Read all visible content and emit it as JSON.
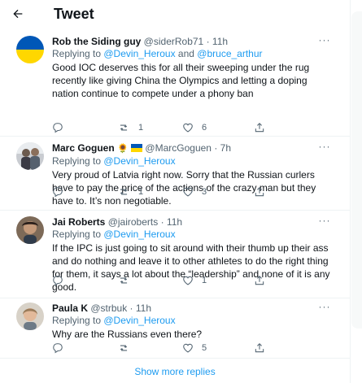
{
  "header": {
    "title": "Tweet"
  },
  "tweets": [
    {
      "name": "Rob the Siding guy",
      "handle": "@siderRob71",
      "time": "11h",
      "reply_prefix": "Replying to ",
      "mention1": "@Devin_Heroux",
      "mention_join": " and ",
      "mention2": "@bruce_arthur",
      "text": "Good IOC deserves this for all their sweeping under the rug recently like giving China the Olympics and letting a doping nation continue to compete under a phony ban",
      "retweets": "1",
      "likes": "6"
    },
    {
      "name": "Marc Goguen",
      "name_emoji": "🌻",
      "handle": "@MarcGoguen",
      "time": "7h",
      "reply_prefix": "Replying to ",
      "mention1": "@Devin_Heroux",
      "text": "Very proud of Latvia right now. Sorry that the Russian curlers have to pay the price of the actions of the crazy man but they have to. It’s non negotiable.",
      "retweets": "1",
      "likes": "3"
    },
    {
      "name": "Jai Roberts",
      "handle": "@jairoberts",
      "time": "11h",
      "reply_prefix": "Replying to ",
      "mention1": "@Devin_Heroux",
      "text": "If the IPC is just going to sit around with their thumb up their ass and do nothing and leave it to other athletes to do the right thing for them, it says a lot about the “leadership” and none of it is any good.",
      "likes": "1"
    },
    {
      "name": "Paula K",
      "handle": "@strbuk",
      "time": "11h",
      "reply_prefix": "Replying to ",
      "mention1": "@Devin_Heroux",
      "text": "Why are the Russians even there?",
      "likes": "5"
    }
  ],
  "separator": " · ",
  "more_glyph": "···",
  "show_more": "Show more replies",
  "colors": {
    "accent": "#1d9bf0",
    "text_primary": "#0f1419",
    "text_secondary": "#536471",
    "divider": "#eff3f4",
    "flag_blue": "#0057b7",
    "flag_yellow": "#ffd700"
  }
}
